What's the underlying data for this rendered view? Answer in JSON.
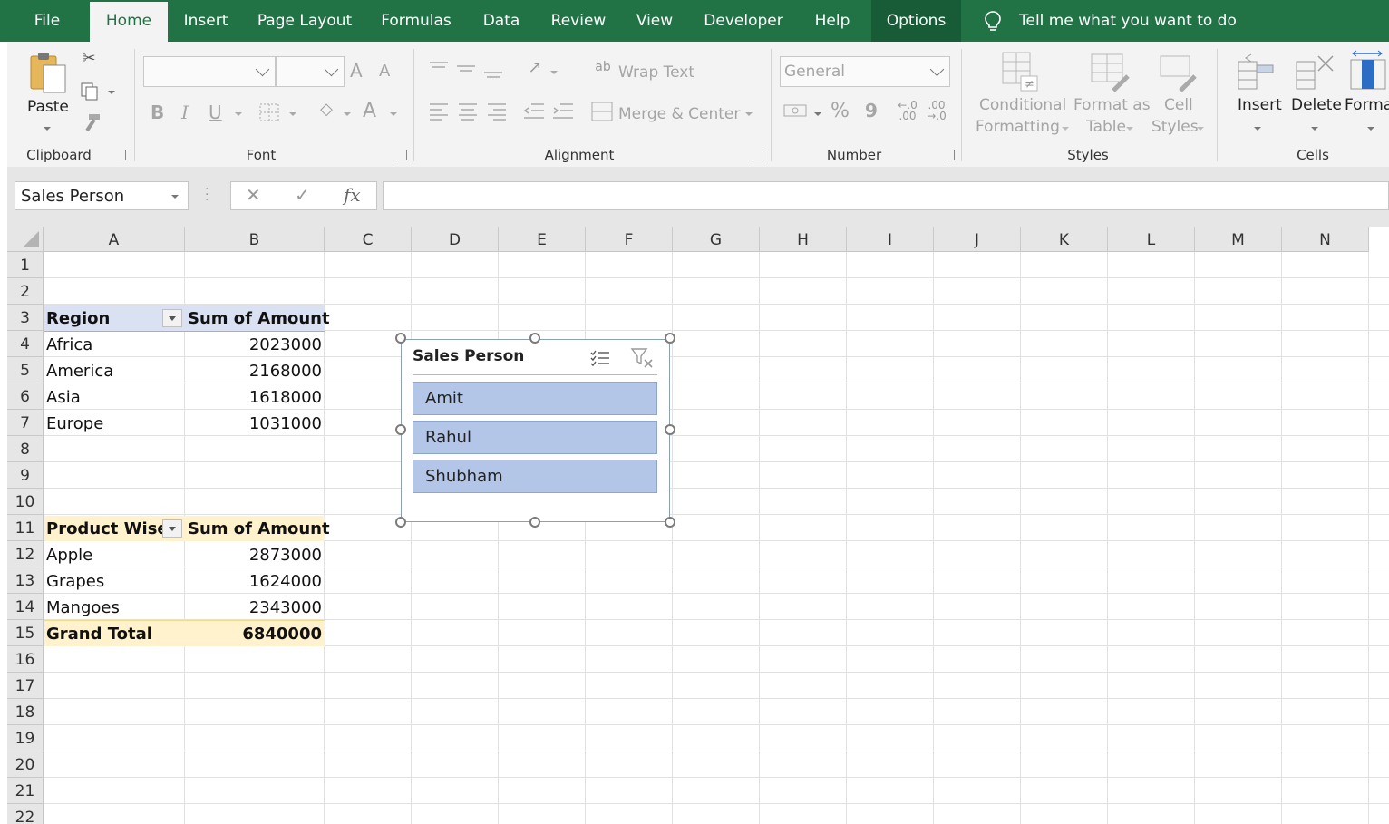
{
  "ribbon_tabs": [
    {
      "label": "File"
    },
    {
      "label": "Home"
    },
    {
      "label": "Insert"
    },
    {
      "label": "Page Layout"
    },
    {
      "label": "Formulas"
    },
    {
      "label": "Data"
    },
    {
      "label": "Review"
    },
    {
      "label": "View"
    },
    {
      "label": "Developer"
    },
    {
      "label": "Help"
    },
    {
      "label": "Options"
    }
  ],
  "tell_me": "Tell me what you want to do",
  "clipboard": {
    "paste": "Paste",
    "label": "Clipboard"
  },
  "font": {
    "label": "Font",
    "bold": "B",
    "italic": "I",
    "underline": "U",
    "grow": "A",
    "shrink": "A",
    "color": "A"
  },
  "alignment": {
    "label": "Alignment",
    "wrap": "Wrap Text",
    "merge": "Merge & Center"
  },
  "number": {
    "label": "Number",
    "format": "General",
    "percent": "%",
    "comma": "9"
  },
  "styles": {
    "label": "Styles",
    "conditional_1": "Conditional",
    "conditional_2": "Formatting",
    "format_table_1": "Format as",
    "format_table_2": "Table",
    "cell_styles_1": "Cell",
    "cell_styles_2": "Styles"
  },
  "cells": {
    "label": "Cells",
    "insert": "Insert",
    "delete": "Delete",
    "format": "Forma"
  },
  "formula_bar": {
    "name_box": "Sales Person",
    "cancel": "✕",
    "enter": "✓",
    "fx": "fx",
    "value": ""
  },
  "columns": [
    "A",
    "B",
    "C",
    "D",
    "E",
    "F",
    "G",
    "H",
    "I",
    "J",
    "K",
    "L",
    "M",
    "N"
  ],
  "rows": [
    "1",
    "2",
    "3",
    "4",
    "5",
    "6",
    "7",
    "8",
    "9",
    "10",
    "11",
    "12",
    "13",
    "14",
    "15",
    "16",
    "17",
    "18",
    "19",
    "20",
    "21",
    "22"
  ],
  "pivot1": {
    "header_label": "Region",
    "header_value": "Sum of Amount",
    "rows": [
      {
        "label": "Africa",
        "value": "2023000"
      },
      {
        "label": "America",
        "value": "2168000"
      },
      {
        "label": "Asia",
        "value": "1618000"
      },
      {
        "label": "Europe",
        "value": "1031000"
      }
    ]
  },
  "pivot2": {
    "header_label": "Product Wise",
    "header_value": "Sum of Amount",
    "rows": [
      {
        "label": "Apple",
        "value": "2873000"
      },
      {
        "label": "Grapes",
        "value": "1624000"
      },
      {
        "label": "Mangoes",
        "value": "2343000"
      }
    ],
    "total_label": "Grand Total",
    "total_value": "6840000"
  },
  "slicer": {
    "title": "Sales Person",
    "items": [
      "Amit",
      "Rahul",
      "Shubham"
    ]
  },
  "colors": {
    "ribbon": "#217346",
    "slicer_item": "#b4c6e7",
    "pivot_header": "#d9e1f2",
    "pivot_yellow": "#fff2cc"
  }
}
